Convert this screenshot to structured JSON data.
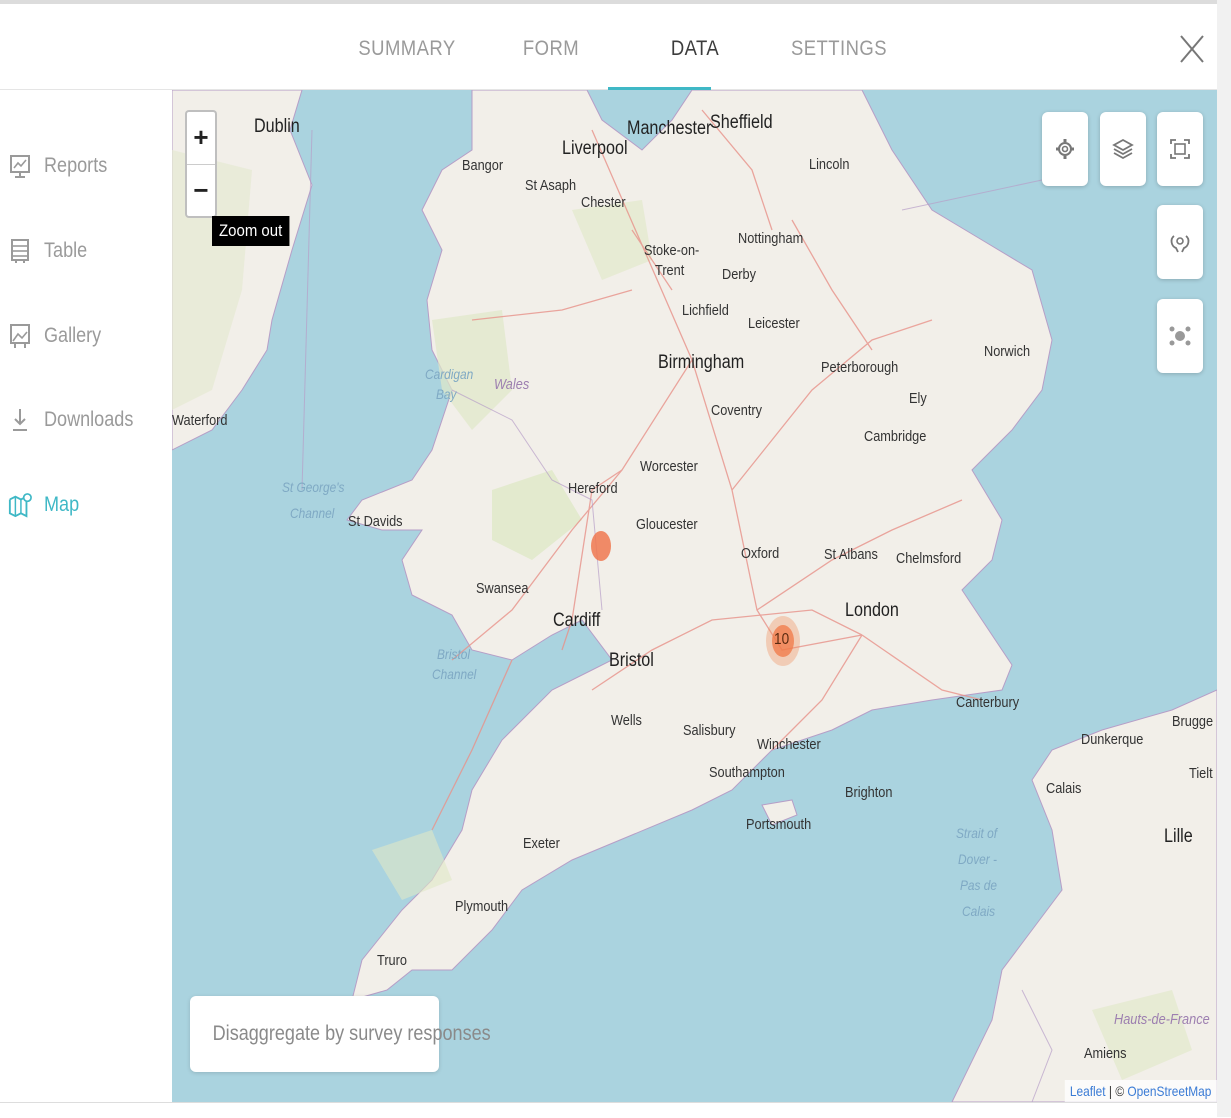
{
  "tabs": [
    {
      "label": "SUMMARY",
      "active": false
    },
    {
      "label": "FORM",
      "active": false
    },
    {
      "label": "DATA",
      "active": true
    },
    {
      "label": "SETTINGS",
      "active": false
    }
  ],
  "sidebar": {
    "items": [
      {
        "label": "Reports",
        "icon": "reports-icon",
        "active": false
      },
      {
        "label": "Table",
        "icon": "table-icon",
        "active": false
      },
      {
        "label": "Gallery",
        "icon": "gallery-icon",
        "active": false
      },
      {
        "label": "Downloads",
        "icon": "download-icon",
        "active": false
      },
      {
        "label": "Map",
        "icon": "map-icon",
        "active": true
      }
    ]
  },
  "map": {
    "zoom_in": "+",
    "zoom_out": "−",
    "tooltip": "Zoom out",
    "cluster_count": "10",
    "disaggregate_label": "Disaggregate by survey responses",
    "attribution": {
      "leaflet": "Leaflet",
      "separator": " | © ",
      "osm": "OpenStreetMap"
    },
    "places": {
      "dublin": "Dublin",
      "liverpool": "Liverpool",
      "manchester": "Manchester",
      "sheffield": "Sheffield",
      "bangor": "Bangor",
      "st_asaph": "St Asaph",
      "chester": "Chester",
      "lincoln": "Lincoln",
      "stoke": "Stoke-on-",
      "trent": "Trent",
      "nottingham": "Nottingham",
      "derby": "Derby",
      "lichfield": "Lichfield",
      "leicester": "Leicester",
      "birmingham": "Birmingham",
      "peterborough": "Peterborough",
      "norwich": "Norwich",
      "ely": "Ely",
      "coventry": "Coventry",
      "cambridge": "Cambridge",
      "waterford": "Waterford",
      "wales": "Wales",
      "cardigan": "Cardigan",
      "bay": "Bay",
      "worcester": "Worcester",
      "hereford": "Hereford",
      "gloucester": "Gloucester",
      "st_georges": "St George's",
      "channel": "Channel",
      "st_davids": "St Davids",
      "oxford": "Oxford",
      "st_albans": "St Albans",
      "chelmsford": "Chelmsford",
      "swansea": "Swansea",
      "cardiff": "Cardiff",
      "london": "London",
      "bristol_channel_1": "Bristol",
      "bristol_channel_2": "Channel",
      "bristol": "Bristol",
      "canterbury": "Canterbury",
      "wells": "Wells",
      "salisbury": "Salisbury",
      "winchester": "Winchester",
      "dunkerque": "Dunkerque",
      "brugge": "Brugge",
      "southampton": "Southampton",
      "tielt": "Tielt",
      "calais": "Calais",
      "brighton": "Brighton",
      "portsmouth": "Portsmouth",
      "strait1": "Strait of",
      "strait2": "Dover -",
      "strait3": "Pas de",
      "strait4": "Calais",
      "lille": "Lille",
      "exeter": "Exeter",
      "plymouth": "Plymouth",
      "truro": "Truro",
      "hauts": "Hauts-de-France",
      "amiens": "Amiens"
    }
  },
  "colors": {
    "accent": "#3fb8c6",
    "sea": "#aad3df",
    "land": "#f2efe9",
    "marker": "#f07850"
  }
}
